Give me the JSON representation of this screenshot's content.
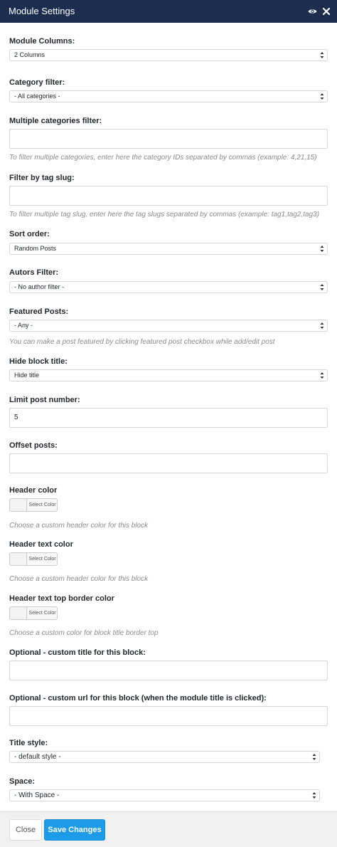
{
  "window": {
    "title": "Module Settings"
  },
  "fields": {
    "module_columns": {
      "label": "Module Columns:",
      "value": "2 Columns"
    },
    "category_filter": {
      "label": "Category filter:",
      "value": "- All categories -"
    },
    "multiple_categories": {
      "label": "Multiple categories filter:",
      "value": "",
      "help": "To filter multiple categories, enter here the category IDs separated by commas (example: 4,21,15)"
    },
    "tag_slug": {
      "label": "Filter by tag slug:",
      "value": "",
      "help": "To filter multiple tag slug, enter here the tag slugs separated by commas (example: tag1,tag2,tag3)"
    },
    "sort_order": {
      "label": "Sort order:",
      "value": "Random Posts"
    },
    "authors_filter": {
      "label": "Autors Filter:",
      "value": "- No author filter -"
    },
    "featured_posts": {
      "label": "Featured Posts:",
      "value": "- Any -",
      "help": "You can make a post featured by clicking featured post checkbox while add/edit post"
    },
    "hide_block_title": {
      "label": "Hide block title:",
      "value": "Hide title"
    },
    "limit_post_number": {
      "label": "Limit post number:",
      "value": "5"
    },
    "offset_posts": {
      "label": "Offset posts:",
      "value": ""
    },
    "header_color": {
      "label": "Header color",
      "button": "Select Color",
      "help": "Choose a custom header color for this block"
    },
    "header_text_color": {
      "label": "Header text color",
      "button": "Select Color",
      "help": "Choose a custom header color for this block"
    },
    "header_text_top_border_color": {
      "label": "Header text top border color",
      "button": "Select Color",
      "help": "Choose a custom color for block title border top"
    },
    "custom_title": {
      "label": "Optional - custom title for this block:",
      "value": ""
    },
    "custom_url": {
      "label": "Optional - custom url for this block (when the module title is clicked):",
      "value": ""
    },
    "title_style": {
      "label": "Title style:",
      "value": "- default style -"
    },
    "space": {
      "label": "Space:",
      "value": "- With Space -"
    }
  },
  "footer": {
    "close_label": "Close",
    "save_label": "Save Changes"
  },
  "colors": {
    "titlebar": "#1d2d4d",
    "save_button": "#1e9be8",
    "footer": "#f1f1f1"
  },
  "icons": {
    "titlebar": [
      "eye-icon",
      "close-icon"
    ],
    "select": "updown-arrow-icon"
  }
}
